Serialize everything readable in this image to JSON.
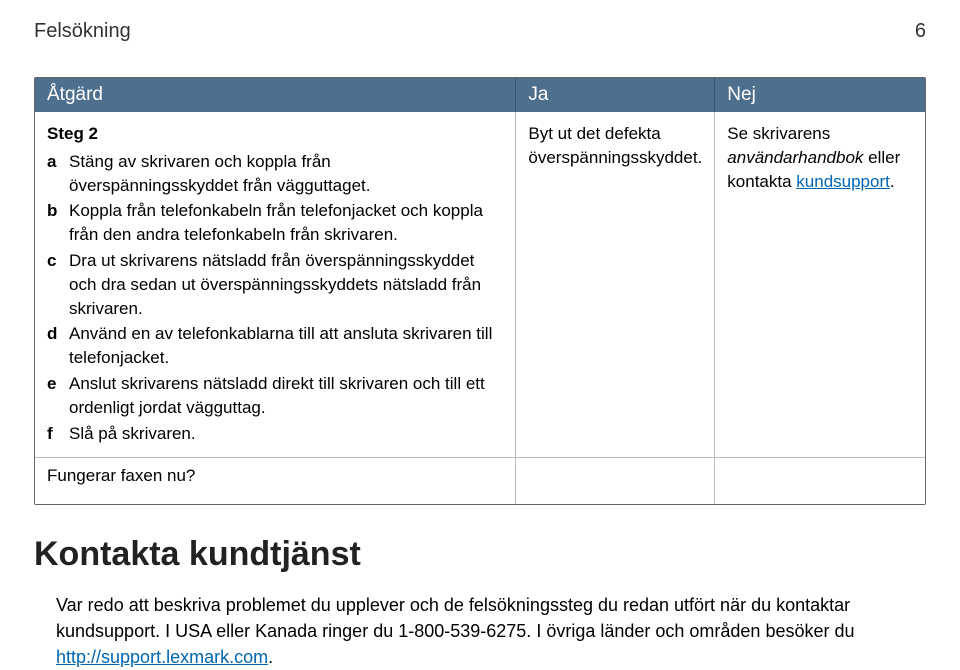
{
  "header": {
    "title": "Felsökning",
    "page": "6"
  },
  "table": {
    "columns": {
      "action": "Åtgärd",
      "yes": "Ja",
      "no": "Nej"
    },
    "step": {
      "title": "Steg 2",
      "items": {
        "a": {
          "marker": "a",
          "text": "Stäng av skrivaren och koppla från överspänningsskyddet från vägguttaget."
        },
        "b": {
          "marker": "b",
          "text": "Koppla från telefonkabeln från telefonjacket och koppla från den andra telefonkabeln från skrivaren."
        },
        "c": {
          "marker": "c",
          "text": "Dra ut skrivarens nätsladd från överspänningsskyddet och dra sedan ut överspänningsskyddets nätsladd från skrivaren."
        },
        "d": {
          "marker": "d",
          "text": "Använd en av telefonkablarna till att ansluta skrivaren till telefonjacket."
        },
        "e": {
          "marker": "e",
          "text": "Anslut skrivarens nätsladd direkt till skrivaren och till ett ordenligt jordat vägguttag."
        },
        "f": {
          "marker": "f",
          "text": "Slå på skrivaren."
        }
      },
      "question": "Fungerar faxen nu?"
    },
    "yes_cell": "Byt ut det defekta överspänningsskyddet.",
    "no_cell": {
      "pre": "Se skrivarens ",
      "italic": "användarhandbok",
      "mid": " eller kontakta ",
      "link": "kundsupport",
      "post": "."
    }
  },
  "contact": {
    "heading": "Kontakta kundtjänst",
    "body": {
      "part1": "Var redo att beskriva problemet du upplever och de felsökningssteg du redan utfört när du kontaktar kundsupport. I USA eller Kanada ringer du 1-800-539-6275. I övriga länder och områden besöker du ",
      "link": "http://support.lexmark.com",
      "part2": "."
    }
  }
}
